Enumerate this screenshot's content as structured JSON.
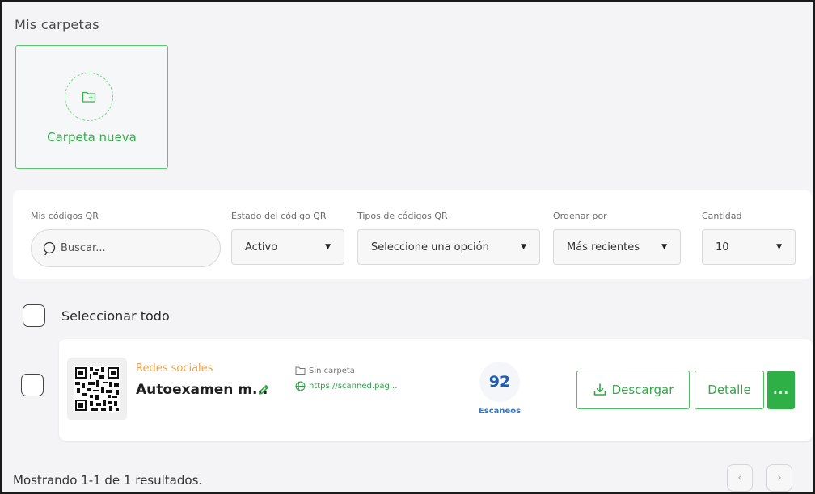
{
  "folders": {
    "title": "Mis carpetas",
    "new_folder_label": "Carpeta nueva"
  },
  "filters": {
    "codes_label": "Mis códigos QR",
    "search_placeholder": "Buscar...",
    "status_label": "Estado del código QR",
    "status_value": "Activo",
    "type_label": "Tipos de códigos QR",
    "type_value": "Seleccione una opción",
    "sort_label": "Ordenar por",
    "sort_value": "Más recientes",
    "qty_label": "Cantidad",
    "qty_value": "10"
  },
  "list": {
    "select_all": "Seleccionar todo",
    "items": [
      {
        "type": "Redes sociales",
        "name": "Autoexamen m...",
        "folder": "Sin carpeta",
        "url": "https://scanned.pag...",
        "scans": "92",
        "scans_label": "Escaneos",
        "download_label": "Descargar",
        "detail_label": "Detalle",
        "more_label": "..."
      }
    ]
  },
  "footer": {
    "results_text": "Mostrando 1-1 de 1 resultados.",
    "prev": "‹",
    "next": "›"
  },
  "colors": {
    "accent_green": "#2fb046",
    "type_orange": "#f0a24a",
    "scan_blue": "#1e5db5"
  }
}
